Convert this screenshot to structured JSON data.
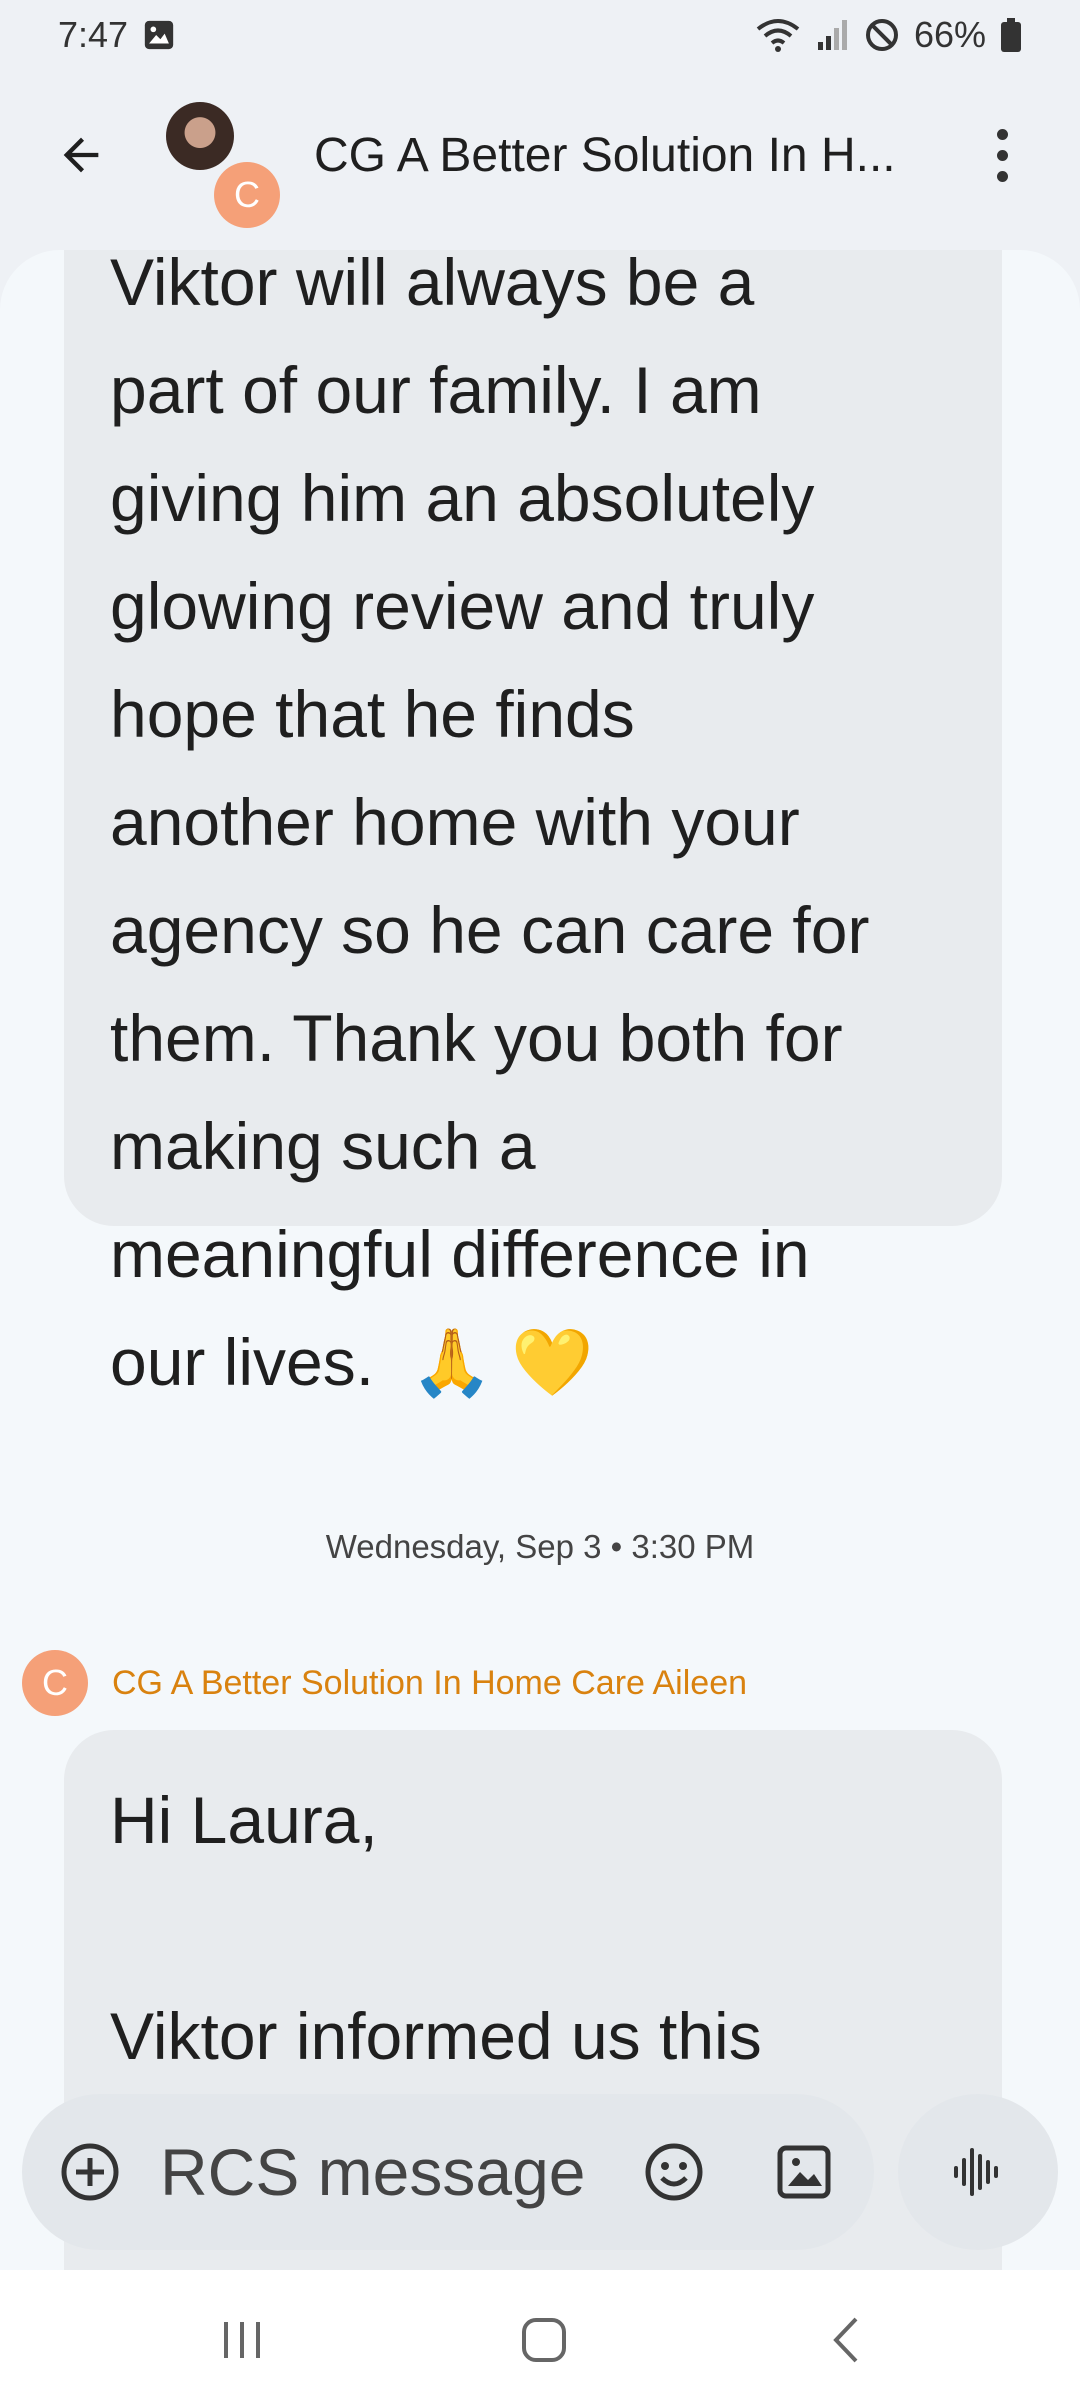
{
  "status_bar": {
    "time": "7:47",
    "battery": "66%"
  },
  "header": {
    "title": "CG A Better Solution In H...",
    "avatar_letter": "C"
  },
  "messages": [
    {
      "text": "Viktor will always be a\npart of our family. I am\ngiving him an absolutely\nglowing review and truly\nhope that he finds\nanother home with your\nagency so he can care for\nthem. Thank you both for\nmaking such a\nmeaningful difference in\nour lives.  🙏 💛"
    }
  ],
  "divider": {
    "date": "Wednesday, Sep 3 • 3:30 PM"
  },
  "sender": {
    "avatar_letter": "C",
    "name": "CG A Better Solution In Home Care Aileen"
  },
  "message2": {
    "text": "Hi Laura,\n\nViktor informed us this"
  },
  "compose": {
    "placeholder": "RCS message"
  },
  "colors": {
    "accent_orange": "#f5a078",
    "sender_name": "#d9820f",
    "bubble": "#e8ebee"
  },
  "icons": {
    "back": "arrow-left-icon",
    "more": "more-vert-icon",
    "plus": "plus-circle-icon",
    "emoji": "emoji-icon",
    "gallery": "gallery-icon",
    "voice": "voice-wave-icon"
  }
}
